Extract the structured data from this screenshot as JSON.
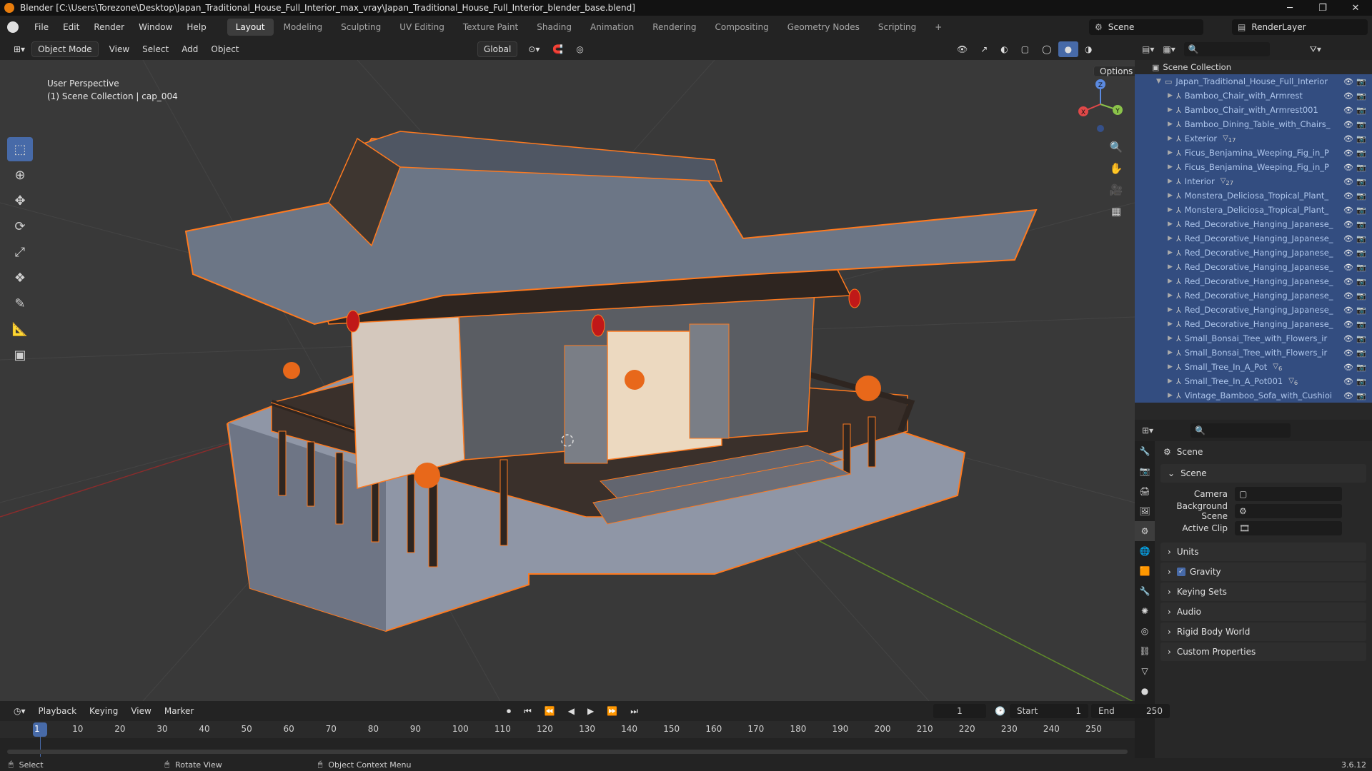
{
  "title": "Blender [C:\\Users\\Torezone\\Desktop\\Japan_Traditional_House_Full_Interior_max_vray\\Japan_Traditional_House_Full_Interior_blender_base.blend]",
  "menu": [
    "File",
    "Edit",
    "Render",
    "Window",
    "Help"
  ],
  "workspaces": [
    "Layout",
    "Modeling",
    "Sculpting",
    "UV Editing",
    "Texture Paint",
    "Shading",
    "Animation",
    "Rendering",
    "Compositing",
    "Geometry Nodes",
    "Scripting"
  ],
  "active_workspace": "Layout",
  "scene_name": "Scene",
  "view_layer": "RenderLayer",
  "viewport": {
    "mode": "Object Mode",
    "menus": [
      "View",
      "Select",
      "Add",
      "Object"
    ],
    "orientation": "Global",
    "options_label": "Options",
    "perspective": "User Perspective",
    "context": "(1) Scene Collection | cap_004"
  },
  "gizmo": {
    "x": "X",
    "y": "Y",
    "z": "Z"
  },
  "outliner": {
    "root": "Scene Collection",
    "collection": "Japan_Traditional_House_Full_Interior",
    "items": [
      {
        "name": "Bamboo_Chair_with_Armrest",
        "badge": ""
      },
      {
        "name": "Bamboo_Chair_with_Armrest001",
        "badge": ""
      },
      {
        "name": "Bamboo_Dining_Table_with_Chairs_",
        "badge": ""
      },
      {
        "name": "Exterior",
        "badge": "17"
      },
      {
        "name": "Ficus_Benjamina_Weeping_Fig_in_P",
        "badge": ""
      },
      {
        "name": "Ficus_Benjamina_Weeping_Fig_in_P",
        "badge": ""
      },
      {
        "name": "Interior",
        "badge": "27"
      },
      {
        "name": "Monstera_Deliciosa_Tropical_Plant_",
        "badge": ""
      },
      {
        "name": "Monstera_Deliciosa_Tropical_Plant_",
        "badge": ""
      },
      {
        "name": "Red_Decorative_Hanging_Japanese_",
        "badge": ""
      },
      {
        "name": "Red_Decorative_Hanging_Japanese_",
        "badge": ""
      },
      {
        "name": "Red_Decorative_Hanging_Japanese_",
        "badge": ""
      },
      {
        "name": "Red_Decorative_Hanging_Japanese_",
        "badge": ""
      },
      {
        "name": "Red_Decorative_Hanging_Japanese_",
        "badge": ""
      },
      {
        "name": "Red_Decorative_Hanging_Japanese_",
        "badge": ""
      },
      {
        "name": "Red_Decorative_Hanging_Japanese_",
        "badge": ""
      },
      {
        "name": "Red_Decorative_Hanging_Japanese_",
        "badge": ""
      },
      {
        "name": "Small_Bonsai_Tree_with_Flowers_ir",
        "badge": ""
      },
      {
        "name": "Small_Bonsai_Tree_with_Flowers_ir",
        "badge": ""
      },
      {
        "name": "Small_Tree_In_A_Pot",
        "badge": "6"
      },
      {
        "name": "Small_Tree_In_A_Pot001",
        "badge": "6"
      },
      {
        "name": "Vintage_Bamboo_Sofa_with_Cushioi",
        "badge": ""
      }
    ]
  },
  "properties": {
    "header": "Scene",
    "panel": "Scene",
    "camera_label": "Camera",
    "bg_scene_label": "Background Scene",
    "active_clip_label": "Active Clip",
    "sections": [
      "Units",
      "Gravity",
      "Keying Sets",
      "Audio",
      "Rigid Body World",
      "Custom Properties"
    ],
    "gravity_checked": true
  },
  "timeline": {
    "menus": [
      "Playback",
      "Keying",
      "View",
      "Marker"
    ],
    "current_frame": "1",
    "start_label": "Start",
    "start": "1",
    "end_label": "End",
    "end": "250",
    "ticks": [
      "1",
      "10",
      "20",
      "30",
      "40",
      "50",
      "60",
      "70",
      "80",
      "90",
      "100",
      "110",
      "120",
      "130",
      "140",
      "150",
      "160",
      "170",
      "180",
      "190",
      "200",
      "210",
      "220",
      "230",
      "240",
      "250"
    ]
  },
  "status": {
    "select": "Select",
    "rotate": "Rotate View",
    "context_menu": "Object Context Menu",
    "version": "3.6.12"
  },
  "colors": {
    "accent": "#ff7a1f",
    "selection": "#476aa8",
    "lantern": "#c01818"
  }
}
